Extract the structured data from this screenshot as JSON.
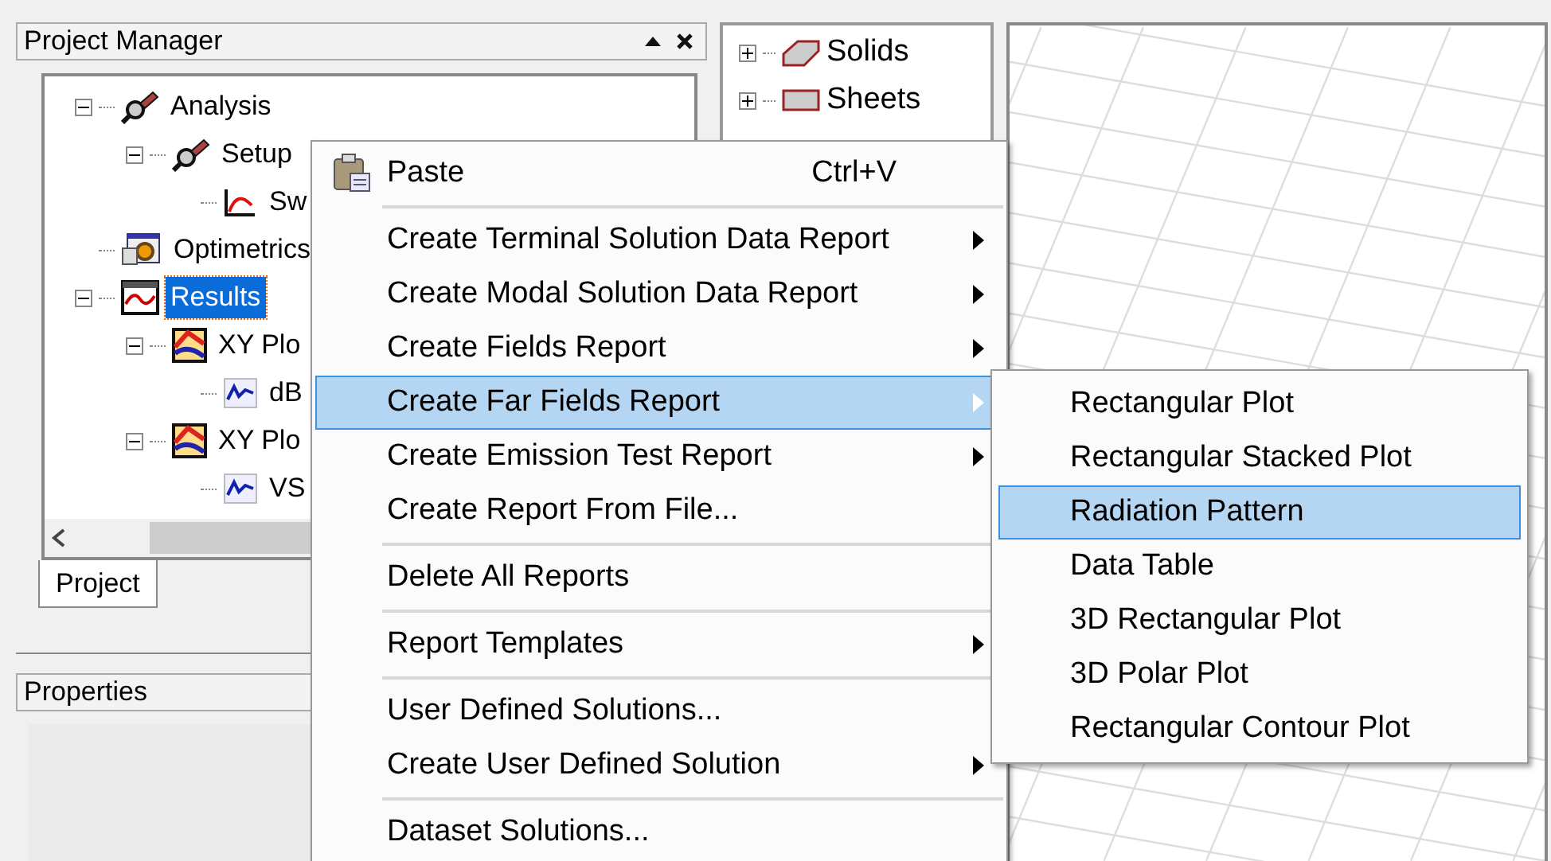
{
  "project_manager": {
    "title": "Project Manager",
    "tree": [
      {
        "label": "Analysis",
        "kind": "analysis",
        "expanded": true,
        "selected": false,
        "children": [
          {
            "label": "Setup",
            "kind": "analysis",
            "expanded": true,
            "selected": false,
            "children": [
              {
                "label": "Sw",
                "kind": "sweep",
                "selected": false
              }
            ]
          }
        ]
      },
      {
        "label": "Optimetrics",
        "kind": "optimetrics",
        "selected": false
      },
      {
        "label": "Results",
        "kind": "results",
        "expanded": true,
        "selected": true,
        "children": [
          {
            "label": "XY Plo",
            "kind": "xyplot",
            "expanded": true,
            "selected": false,
            "children": [
              {
                "label": "dB",
                "kind": "trace",
                "selected": false
              }
            ]
          },
          {
            "label": "XY Plo",
            "kind": "xyplot",
            "expanded": true,
            "selected": false,
            "children": [
              {
                "label": "VS",
                "kind": "trace",
                "selected": false
              }
            ]
          }
        ]
      }
    ],
    "tabs": [
      {
        "label": "Project",
        "selected": true
      }
    ]
  },
  "properties": {
    "title": "Properties"
  },
  "model_tree": [
    {
      "label": "Solids",
      "kind": "solid",
      "expanded": false
    },
    {
      "label": "Sheets",
      "kind": "sheet",
      "expanded": false
    }
  ],
  "context_menu": {
    "items": [
      {
        "kind": "paste",
        "label": "Paste",
        "shortcut": "Ctrl+V",
        "submenu": false,
        "selected": false
      },
      {
        "kind": "separator"
      },
      {
        "kind": "item",
        "label": "Create Terminal Solution Data Report",
        "submenu": true,
        "selected": false
      },
      {
        "kind": "item",
        "label": "Create Modal Solution Data Report",
        "submenu": true,
        "selected": false
      },
      {
        "kind": "item",
        "label": "Create Fields Report",
        "submenu": true,
        "selected": false
      },
      {
        "kind": "item",
        "label": "Create Far Fields Report",
        "submenu": true,
        "selected": true
      },
      {
        "kind": "item",
        "label": "Create Emission Test Report",
        "submenu": true,
        "selected": false
      },
      {
        "kind": "item",
        "label": "Create Report From File...",
        "submenu": false,
        "selected": false
      },
      {
        "kind": "separator"
      },
      {
        "kind": "item",
        "label": "Delete All Reports",
        "submenu": false,
        "selected": false
      },
      {
        "kind": "separator"
      },
      {
        "kind": "item",
        "label": "Report Templates",
        "submenu": true,
        "selected": false
      },
      {
        "kind": "separator"
      },
      {
        "kind": "item",
        "label": "User Defined Solutions...",
        "submenu": false,
        "selected": false
      },
      {
        "kind": "item",
        "label": "Create User Defined Solution",
        "submenu": true,
        "selected": false
      },
      {
        "kind": "separator"
      },
      {
        "kind": "item",
        "label": "Dataset Solutions...",
        "submenu": false,
        "selected": false
      }
    ]
  },
  "submenu": {
    "items": [
      {
        "label": "Rectangular Plot",
        "selected": false
      },
      {
        "label": "Rectangular Stacked Plot",
        "selected": false
      },
      {
        "label": "Radiation Pattern",
        "selected": true
      },
      {
        "label": "Data Table",
        "selected": false
      },
      {
        "label": "3D Rectangular Plot",
        "selected": false
      },
      {
        "label": "3D Polar Plot",
        "selected": false
      },
      {
        "label": "Rectangular Contour Plot",
        "selected": false
      }
    ]
  }
}
